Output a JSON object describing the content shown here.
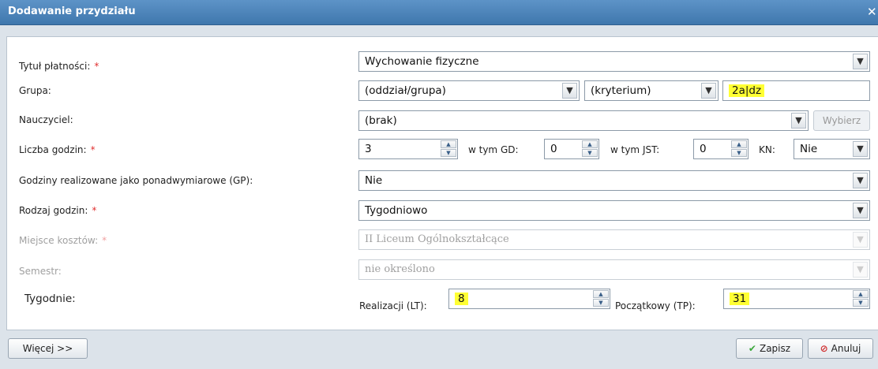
{
  "dialog": {
    "title": "Dodawanie przydziału",
    "close_icon": "close-icon"
  },
  "required_marker": "*",
  "rows": {
    "tytul": {
      "label": "Tytuł płatności:",
      "value": "Wychowanie fizyczne"
    },
    "grupa": {
      "label": "Grupa:",
      "oddzial": "(oddział/grupa)",
      "kryterium": "(kryterium)",
      "name": "2a|dz"
    },
    "nauczyciel": {
      "label": "Nauczyciel:",
      "value": "(brak)",
      "choose_button": "Wybierz"
    },
    "liczba": {
      "label": "Liczba godzin:",
      "value": "3",
      "gd_label": "w tym GD:",
      "gd_value": "0",
      "jst_label": "w tym JST:",
      "jst_value": "0",
      "kn_label": "KN:",
      "kn_value": "Nie"
    },
    "gp": {
      "label": "Godziny realizowane jako ponadwymiarowe (GP):",
      "value": "Nie"
    },
    "rodzaj": {
      "label": "Rodzaj godzin:",
      "value": "Tygodniowo"
    },
    "miejsce": {
      "label": "Miejsce kosztów:",
      "value": "II Liceum Ogólnokształcące"
    },
    "semestr": {
      "label": "Semestr:",
      "value": "nie określono"
    },
    "tygodnie": {
      "label": "Tygodnie:",
      "lt_label": "Realizacji (LT):",
      "lt_value": "8",
      "tp_label": "Początkowy (TP):",
      "tp_value": "31"
    }
  },
  "footer": {
    "more_button": "Więcej >>",
    "save_button": "Zapisz",
    "cancel_button": "Anuluj"
  },
  "colors": {
    "title_bar": "#4a82b8",
    "highlight": "#ffff33",
    "required": "#e03030"
  }
}
